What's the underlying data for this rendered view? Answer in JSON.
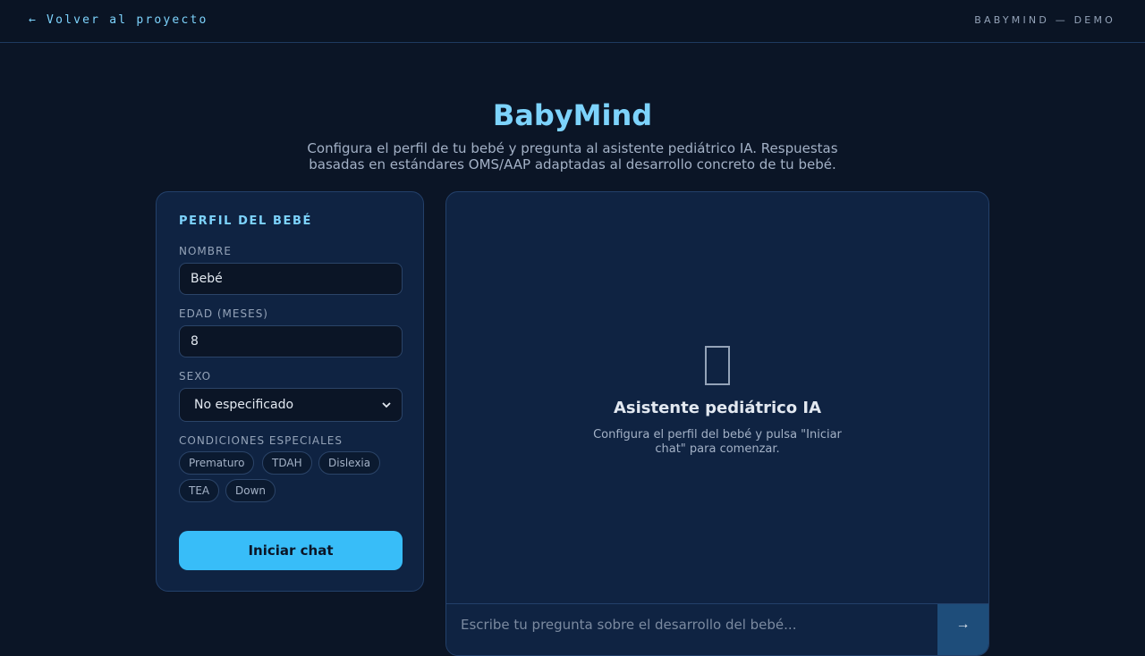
{
  "topbar": {
    "back_label": "← Volver al proyecto",
    "brand": "BABYMIND — DEMO"
  },
  "header": {
    "title": "BabyMind",
    "subtitle": "Configura el perfil de tu bebé y pregunta al asistente pediátrico IA. Respuestas basadas en estándares OMS/AAP adaptadas al desarrollo concreto de tu bebé."
  },
  "profile": {
    "heading": "PERFIL DEL BEBÉ",
    "name_label": "NOMBRE",
    "name_value": "Bebé",
    "age_label": "EDAD (MESES)",
    "age_value": "8",
    "sex_label": "SEXO",
    "sex_value": "No especificado",
    "conditions_label": "CONDICIONES ESPECIALES",
    "conditions": [
      "Prematuro",
      "TDAH",
      "Dislexia",
      "TEA",
      "Down"
    ],
    "start_button": "Iniciar chat"
  },
  "chat": {
    "empty_title": "Asistente pediátrico IA",
    "empty_desc": "Configura el perfil del bebé y pulsa \"Iniciar chat\" para comenzar.",
    "input_placeholder": "Escribe tu pregunta sobre el desarrollo del bebé...",
    "send_label": "→"
  },
  "colors": {
    "accent": "#38bdf8",
    "background": "#0b1526",
    "panel": "#0f2342"
  }
}
